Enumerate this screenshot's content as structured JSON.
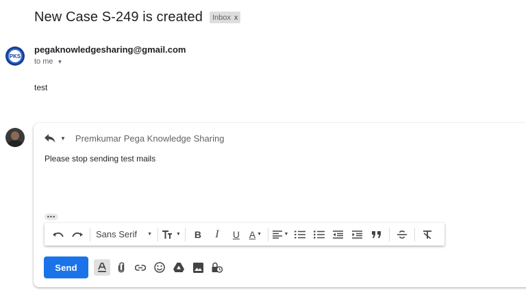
{
  "subject": "New Case S-249 is created",
  "label": {
    "text": "Inbox",
    "close": "x"
  },
  "message": {
    "sender_email": "pegaknowledgesharing@gmail.com",
    "avatar_text": "PKS",
    "to": "to me",
    "body": "test"
  },
  "reply": {
    "recipients": "Premkumar Pega Knowledge Sharing",
    "body": "Please stop sending test mails",
    "more": "•••"
  },
  "toolbar": {
    "font": "Sans Serif",
    "bold": "B",
    "italic": "I",
    "underline": "U",
    "text_color": "A"
  },
  "actions": {
    "send_label": "Send"
  },
  "colors": {
    "send_button": "#1a73e8",
    "label_chip": "#dddddd"
  },
  "icons": [
    "reply-icon",
    "undo-icon",
    "redo-icon",
    "text-size-icon",
    "align-icon",
    "numbered-list-icon",
    "bulleted-list-icon",
    "indent-less-icon",
    "indent-more-icon",
    "quote-icon",
    "strikethrough-icon",
    "remove-formatting-icon",
    "formatting-options-icon",
    "attach-icon",
    "link-icon",
    "emoji-icon",
    "drive-icon",
    "photo-icon",
    "confidential-icon"
  ]
}
